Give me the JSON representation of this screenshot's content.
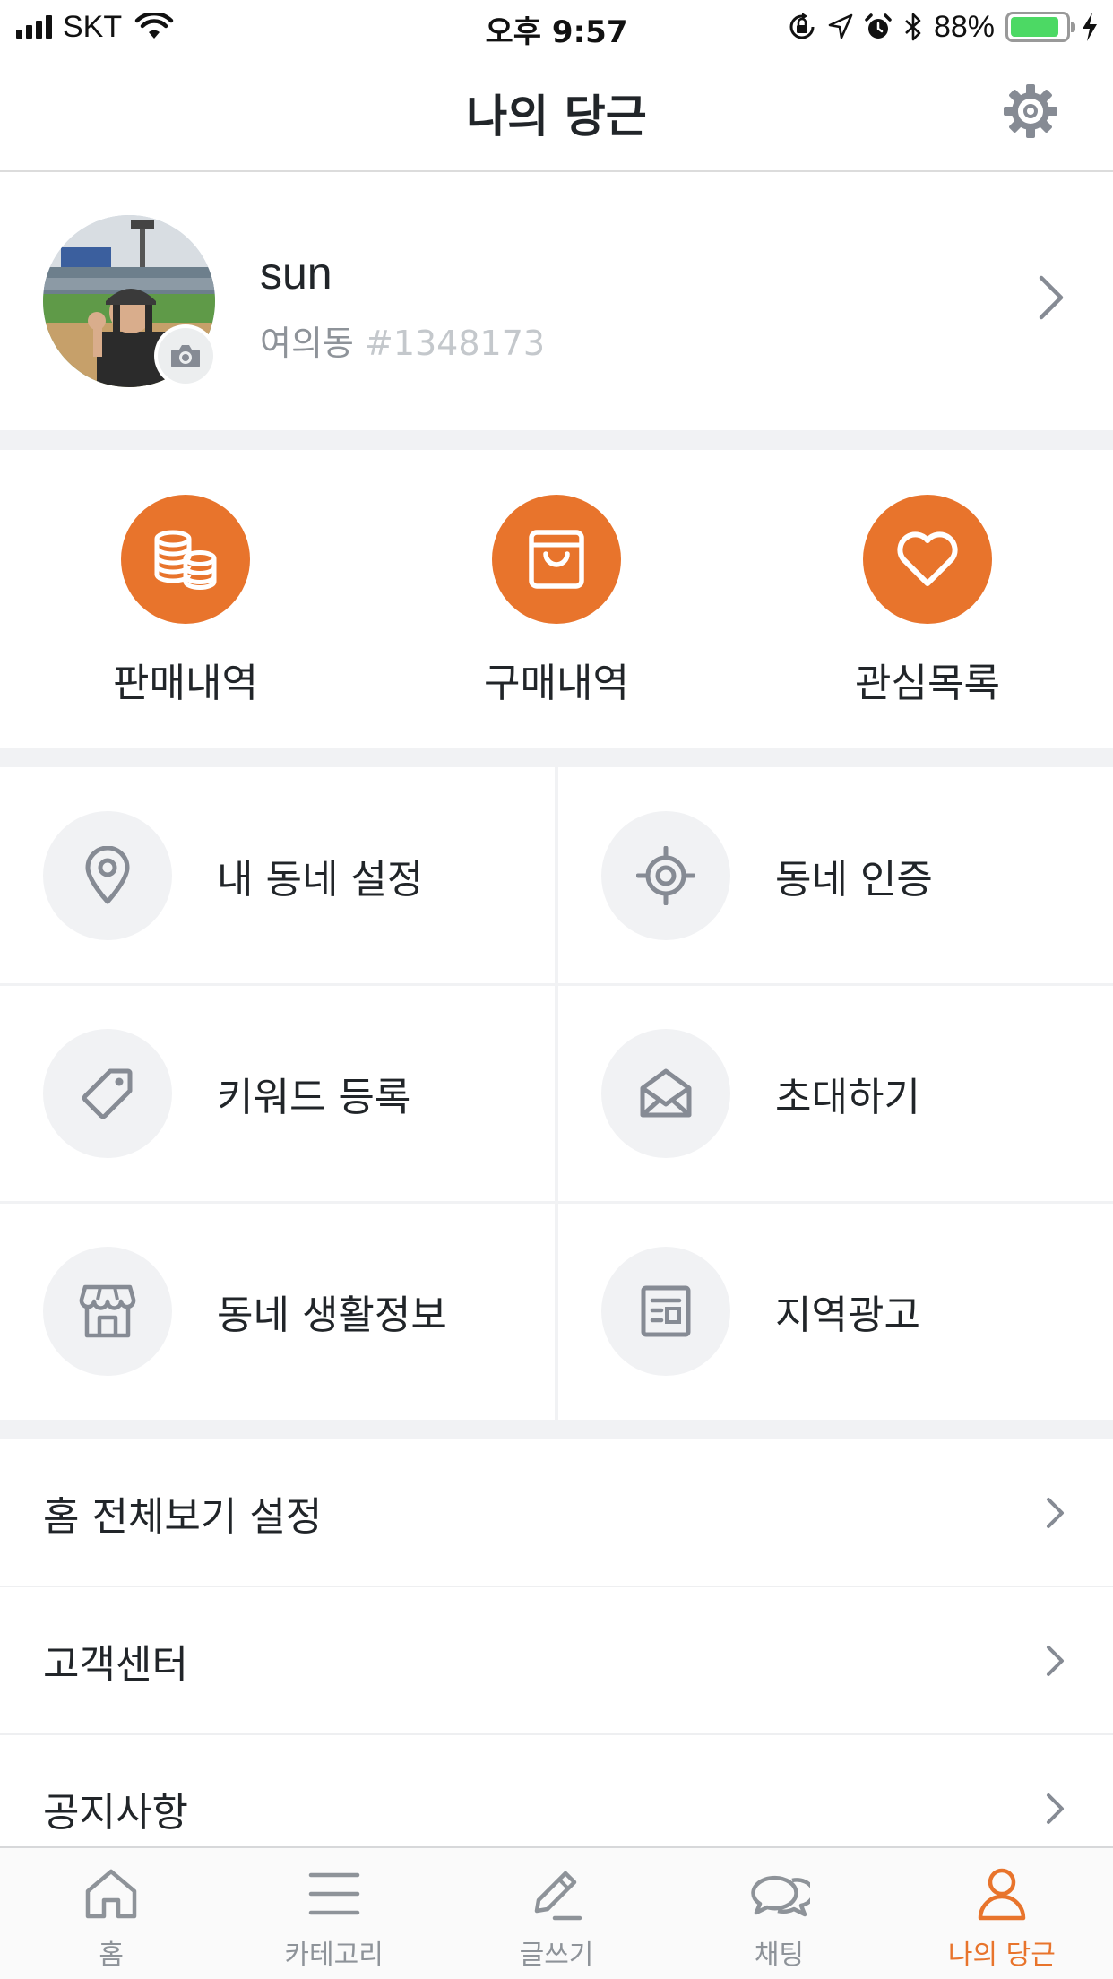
{
  "status_bar": {
    "carrier": "SKT",
    "time": "오후 9:57",
    "battery_percent": "88%",
    "battery_level": 0.88,
    "icons": [
      "signal-icon",
      "wifi-icon",
      "orientation-lock-icon",
      "location-icon",
      "alarm-icon",
      "bluetooth-icon",
      "battery-icon",
      "charging-icon"
    ]
  },
  "header": {
    "title": "나의 당근",
    "settings_icon": "gear-icon"
  },
  "profile": {
    "name": "sun",
    "town": "여의동",
    "id": "#1348173"
  },
  "quick_actions": [
    {
      "label": "판매내역",
      "icon": "coins-icon"
    },
    {
      "label": "구매내역",
      "icon": "shopping-bag-icon"
    },
    {
      "label": "관심목록",
      "icon": "heart-icon"
    }
  ],
  "grid_menu": [
    {
      "label": "내 동네 설정",
      "icon": "map-pin-icon"
    },
    {
      "label": "동네 인증",
      "icon": "target-icon"
    },
    {
      "label": "키워드 등록",
      "icon": "tag-icon"
    },
    {
      "label": "초대하기",
      "icon": "envelope-open-icon"
    },
    {
      "label": "동네 생활정보",
      "icon": "store-icon"
    },
    {
      "label": "지역광고",
      "icon": "newspaper-icon"
    }
  ],
  "list_menu": [
    {
      "label": "홈 전체보기 설정"
    },
    {
      "label": "고객센터"
    },
    {
      "label": "공지사항"
    }
  ],
  "tab_bar": {
    "active_index": 4,
    "tabs": [
      {
        "label": "홈",
        "icon": "home-icon"
      },
      {
        "label": "카테고리",
        "icon": "menu-icon"
      },
      {
        "label": "글쓰기",
        "icon": "pencil-icon"
      },
      {
        "label": "채팅",
        "icon": "chat-icon"
      },
      {
        "label": "나의 당근",
        "icon": "user-icon"
      }
    ]
  },
  "colors": {
    "accent": "#e8742c",
    "icon_gray": "#868b94",
    "background_gray": "#f1f2f4",
    "text": "#212529"
  }
}
